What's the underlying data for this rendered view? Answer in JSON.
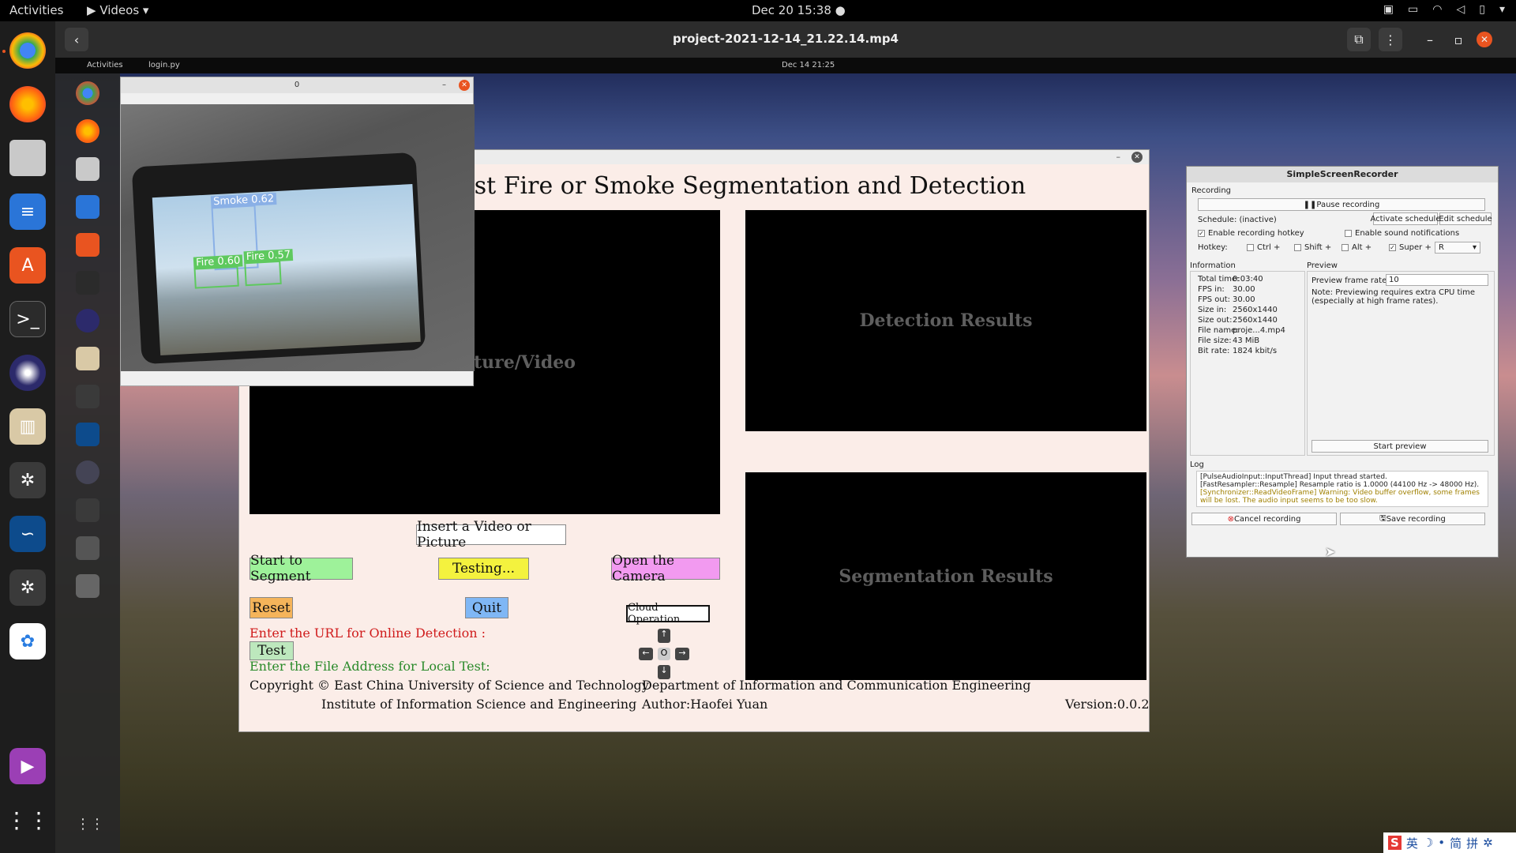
{
  "topbar": {
    "activities": "Activities",
    "app_menu": "Videos",
    "clock": "Dec 20  15:38"
  },
  "player": {
    "title": "project-2021-12-14_21.22.14.mp4"
  },
  "video": {
    "topbar": {
      "activities": "Activities",
      "app": "login.py",
      "clock": "Dec 14  21:25"
    },
    "cv_window": {
      "title": "0",
      "detections": [
        {
          "label": "Smoke 0.62",
          "color": "#8ab0e6"
        },
        {
          "label": "Fire 0.60",
          "color": "#5ec95e"
        },
        {
          "label": "Fire 0.57",
          "color": "#5ec95e"
        }
      ]
    },
    "app": {
      "heading": "est Fire or Smoke Segmentation and Detection",
      "panel_input": "ture/Video",
      "panel_detection": "Detection Results",
      "panel_segmentation": "Segmentation Results",
      "btn_insert": "Insert a Video or Picture",
      "btn_segment": "Start to Segment",
      "btn_testing": "Testing...",
      "btn_camera": "Open the Camera",
      "btn_reset": "Reset",
      "btn_quit": "Quit",
      "cloud_label": "Cloud Operation",
      "dpad_center": "O",
      "url_prompt": "Enter the URL for Online Detection :",
      "btn_test": "Test",
      "file_prompt": "Enter the File Address for Local Test:",
      "copyright": "Copyright © East China University of Science and Technology",
      "institute": "Institute of Information Science and Engineering",
      "department": "Department of Information and Communication Engineering",
      "author": "Author:Haofei Yuan",
      "version": "Version:0.0.2",
      "colors": {
        "segment": "#9ef29a",
        "testing": "#f4f23e",
        "camera": "#f29af0",
        "reset": "#f5b45a",
        "quit": "#7fb7f5",
        "test": "#bde8bd"
      }
    },
    "ssr": {
      "title": "SimpleScreenRecorder",
      "recording_section": "Recording",
      "pause": "Pause recording",
      "schedule": "Schedule: (inactive)",
      "activate_schedule": "Activate schedule",
      "edit_schedule": "Edit schedule",
      "enable_hotkey": "Enable recording hotkey",
      "enable_sound": "Enable sound notifications",
      "hotkey": "Hotkey:",
      "ctrl": "Ctrl +",
      "shift": "Shift +",
      "alt": "Alt +",
      "super": "Super +",
      "key": "R",
      "information": "Information",
      "info_rows": [
        {
          "k": "Total time:",
          "v": "0:03:40"
        },
        {
          "k": "FPS in:",
          "v": "30.00"
        },
        {
          "k": "FPS out:",
          "v": "30.00"
        },
        {
          "k": "Size in:",
          "v": "2560x1440"
        },
        {
          "k": "Size out:",
          "v": "2560x1440"
        },
        {
          "k": "File name:",
          "v": "proje...4.mp4"
        },
        {
          "k": "File size:",
          "v": "43 MiB"
        },
        {
          "k": "Bit rate:",
          "v": "1824 kbit/s"
        }
      ],
      "preview": "Preview",
      "preview_rate_label": "Preview frame rate:",
      "preview_rate": "10",
      "preview_note": "Note: Previewing requires extra CPU time (especially at high frame rates).",
      "start_preview": "Start preview",
      "log": "Log",
      "log_lines": [
        "[PulseAudioInput::InputThread] Input thread started.",
        "[FastResampler::Resample] Resample ratio is 1.0000 (44100 Hz -> 48000 Hz).",
        "[Synchronizer::ReadVideoFrame] Warning: Video buffer overflow, some frames will be lost. The audio input seems to be too slow."
      ],
      "cancel": "Cancel recording",
      "save": "Save recording"
    }
  },
  "ime": {
    "chars": [
      "S",
      "英",
      "☽",
      "•",
      "简",
      "拼",
      "✲"
    ]
  }
}
